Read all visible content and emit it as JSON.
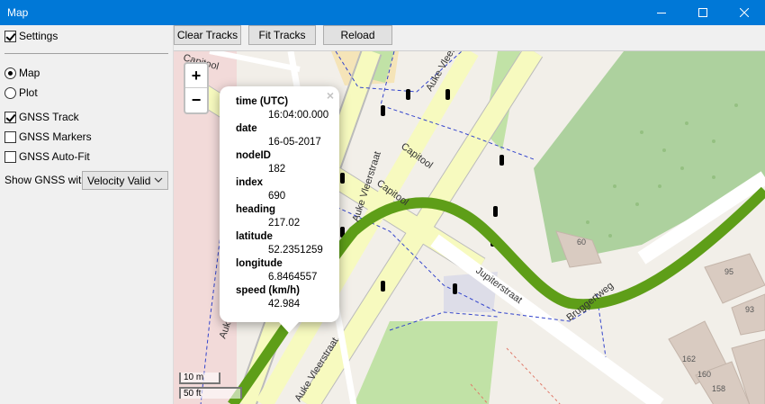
{
  "window": {
    "title": "Map"
  },
  "sidebar": {
    "settings_label": "Settings",
    "settings_checked": true,
    "mode_map": "Map",
    "mode_plot": "Plot",
    "gnss_track": "GNSS Track",
    "gnss_markers": "GNSS Markers",
    "gnss_autofit": "GNSS Auto-Fit",
    "show_gnss_with_label": "Show GNSS with",
    "show_gnss_with_value": "Velocity Valid"
  },
  "toolbar": {
    "clear_tracks": "Clear Tracks",
    "fit_tracks": "Fit Tracks",
    "reload": "Reload"
  },
  "map": {
    "zoom_in": "+",
    "zoom_out": "−",
    "popup": {
      "close": "×",
      "fields": [
        {
          "label": "time (UTC)",
          "value": "16:04:00.000"
        },
        {
          "label": "date",
          "value": "16-05-2017"
        },
        {
          "label": "nodeID",
          "value": "182"
        },
        {
          "label": "index",
          "value": "690"
        },
        {
          "label": "heading",
          "value": "217.02"
        },
        {
          "label": "latitude",
          "value": "52.2351259"
        },
        {
          "label": "longitude",
          "value": "6.8464557"
        },
        {
          "label": "speed (km/h)",
          "value": "42.984"
        }
      ]
    },
    "street_labels": [
      "Auke Vleerstraat",
      "Capitool",
      "Capitool",
      "Jupiterstraat",
      "Bruggertweg",
      "Auke Vleerstraat",
      "Auke Vleerstraat",
      "Capitool",
      "Auke"
    ],
    "house_numbers": [
      "60",
      "95",
      "93",
      "162",
      "160",
      "158"
    ],
    "scale_metric": "10 m",
    "scale_imperial": "50 ft",
    "colors": {
      "track": "#5e9e18",
      "major_road": "#f7fabf",
      "minor_road": "#ffffff",
      "grass": "#c1e2a6",
      "forest": "#add19e"
    }
  }
}
